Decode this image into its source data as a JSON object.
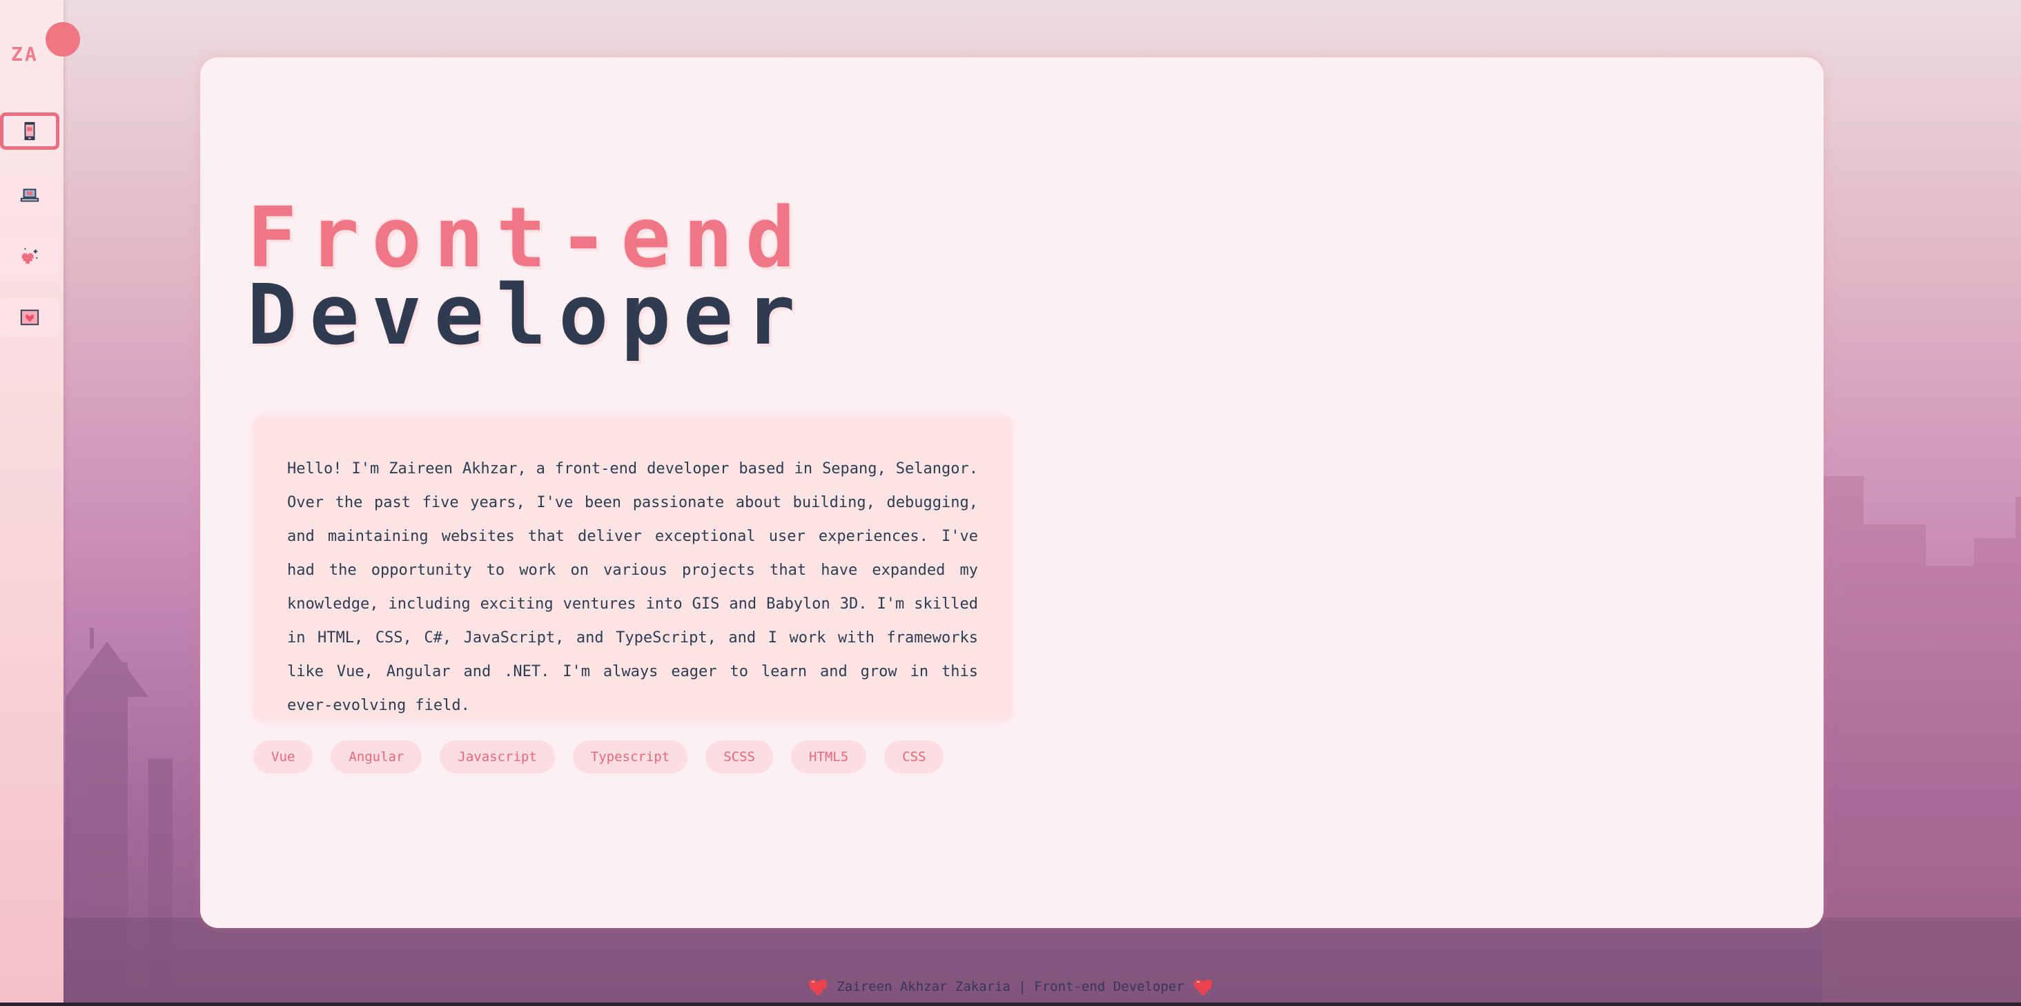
{
  "sidebar": {
    "logo": "ZA",
    "items": [
      {
        "icon": "mobile-phone-icon",
        "active": true
      },
      {
        "icon": "laptop-icon",
        "active": false
      },
      {
        "icon": "sparkle-heart-icon",
        "active": false
      },
      {
        "icon": "envelope-heart-icon",
        "active": false
      }
    ]
  },
  "hero": {
    "title_line1": "Front-end",
    "title_line2": "Developer"
  },
  "bio": "Hello! I'm Zaireen Akhzar, a front-end developer based in Sepang, Selangor. Over the past five years, I've been passionate about building, debugging, and maintaining websites that deliver exceptional user experiences. I've had the opportunity to work on various projects that have expanded my knowledge, including exciting ventures into GIS and Babylon 3D. I'm skilled in HTML, CSS, C#, JavaScript, and TypeScript, and I work with frameworks like Vue, Angular and .NET. I'm always eager to learn and grow in this ever-evolving field.",
  "tags": [
    "Vue",
    "Angular",
    "Javascript",
    "Typescript",
    "SCSS",
    "HTML5",
    "CSS"
  ],
  "footer": "Zaireen Akhzar Zakaria | Front-end Developer",
  "colors": {
    "accent": "#ee7685",
    "dark": "#2f3c50",
    "card": "#fdf0f3",
    "tag_bg": "#fbdde2"
  }
}
